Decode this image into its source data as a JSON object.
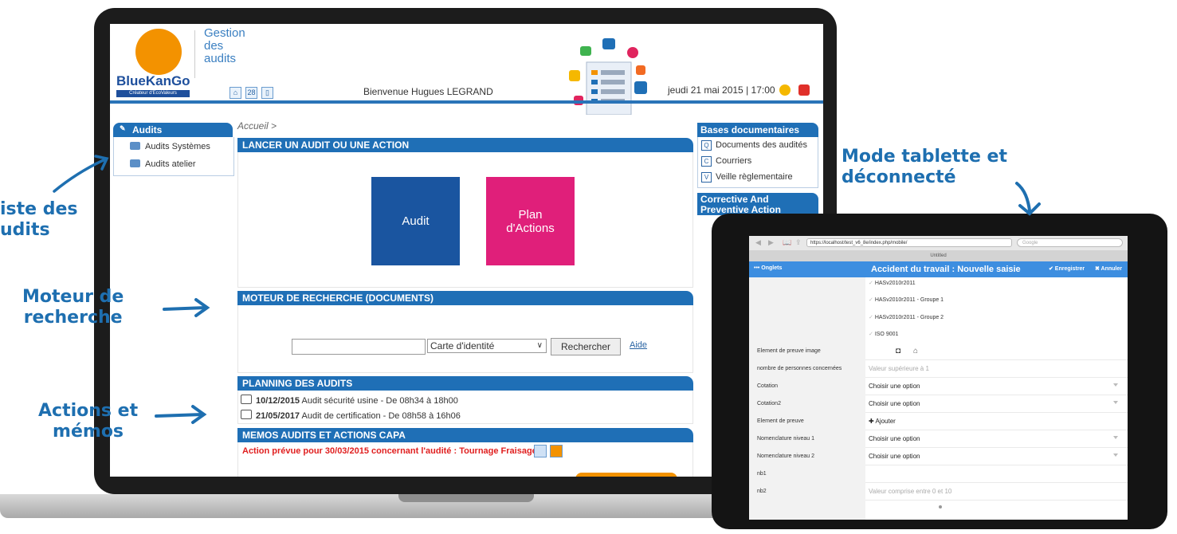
{
  "app": {
    "brand": "BlueKanGo",
    "brand_tagline": "Créateur d'EcoValeurs",
    "title_lines": [
      "Gestion",
      "des",
      "audits"
    ],
    "welcome": "Bienvenue Hugues LEGRAND",
    "datetime": "jeudi 21 mai 2015 | 17:00",
    "header_icons": [
      "home-icon",
      "calendar-icon",
      "tablet-icon"
    ],
    "header_right_icons": [
      "bell-icon",
      "power-icon"
    ]
  },
  "left_nav": {
    "title": "Audits",
    "items": [
      {
        "label": "Audits Systèmes",
        "icon": "folder-icon"
      },
      {
        "label": "Audits atelier",
        "icon": "folder-icon"
      }
    ]
  },
  "breadcrumb": "Accueil >",
  "launch": {
    "title": "LANCER UN AUDIT OU UNE ACTION",
    "tiles": [
      {
        "label": "Audit",
        "color": "#1a55a0"
      },
      {
        "label": "Plan\nd'Actions",
        "color": "#e01f7a"
      }
    ]
  },
  "search": {
    "title": "MOTEUR DE RECHERCHE (DOCUMENTS)",
    "input_value": "",
    "select_value": "Carte d'identité",
    "button": "Rechercher",
    "help": "Aide"
  },
  "planning": {
    "title": "PLANNING DES AUDITS",
    "items": [
      {
        "date": "10/12/2015",
        "text": "Audit sécurité usine - De 08h34 à 18h00"
      },
      {
        "date": "21/05/2017",
        "text": "Audit de certification - De 08h58 à 16h06"
      }
    ]
  },
  "memos": {
    "title": "MEMOS AUDITS ET ACTIONS CAPA",
    "item": "Action prévue pour 30/03/2015 concernant l'audité : Tournage Fraisage"
  },
  "right_nav": {
    "bases_title": "Bases documentaires",
    "bases_items": [
      {
        "icon_letter": "Q",
        "label": "Documents des audités"
      },
      {
        "icon_letter": "C",
        "label": "Courriers"
      },
      {
        "icon_letter": "V",
        "label": "Veille règlementaire"
      }
    ],
    "capa_title": "Corrective And Preventive Action"
  },
  "tablet": {
    "url": "https://localhost/test_v6_8e/index.php/mobile/",
    "search_placeholder": "Google",
    "tab_title": "Untitled",
    "onglets": "••• Onglets",
    "form_title": "Accident du travail : Nouvelle saisie",
    "save": "✔ Enregistrer",
    "cancel": "✖ Annuler",
    "checklist": [
      "HASv2010r2011",
      "HASv2010r2011 - Groupe 1",
      "HASv2010r2011 - Groupe 2",
      "ISO 9001"
    ],
    "rows": [
      {
        "label": "Element de preuve image",
        "value": "",
        "kind": "icons"
      },
      {
        "label": "nombre de personnes concernées",
        "value": "Valeur supérieure à 1",
        "kind": "placeholder"
      },
      {
        "label": "Cotation",
        "value": "Choisir une option",
        "kind": "select"
      },
      {
        "label": "Cotation2",
        "value": "Choisir une option",
        "kind": "select"
      },
      {
        "label": "Element de preuve",
        "value": "✚ Ajouter",
        "kind": "text"
      },
      {
        "label": "Nomenclature niveau 1",
        "value": "Choisir une option",
        "kind": "select"
      },
      {
        "label": "Nomenclature niveau 2",
        "value": "Choisir une option",
        "kind": "select"
      },
      {
        "label": "nb1",
        "value": "",
        "kind": "text"
      },
      {
        "label": "nb2",
        "value": "Valeur comprise entre 0 et 10",
        "kind": "placeholder"
      }
    ]
  },
  "annotations": {
    "liste": "iste des\nudits",
    "moteur": "Moteur de\nrecherche",
    "actions": "Actions et\nmémos",
    "tablette": "Mode tablette et\ndéconnecté"
  }
}
